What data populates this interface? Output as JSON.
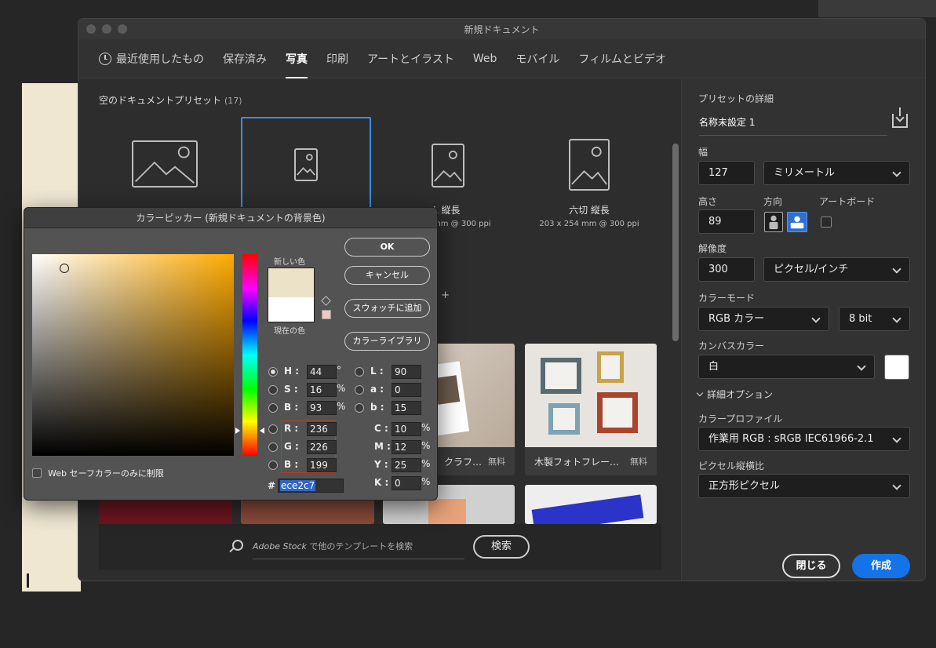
{
  "main_dialog": {
    "title": "新規ドキュメント",
    "tabs": [
      {
        "label": "最近使用したもの",
        "active": false
      },
      {
        "label": "保存済み",
        "active": false
      },
      {
        "label": "写真",
        "active": true
      },
      {
        "label": "印刷",
        "active": false
      },
      {
        "label": "アートとイラスト",
        "active": false
      },
      {
        "label": "Web",
        "active": false
      },
      {
        "label": "モバイル",
        "active": false
      },
      {
        "label": "フィルムとビデオ",
        "active": false
      }
    ]
  },
  "presets": {
    "header": "空のドキュメントプリセット",
    "count": "(17)",
    "items": [
      {
        "name": "",
        "sub": ""
      },
      {
        "name": "",
        "sub": ""
      },
      {
        "name": "L 縦長",
        "sub": "mm @ 300 ppi"
      },
      {
        "name": "六切 縦長",
        "sub": "203 x 254 mm @ 300 ppi"
      }
    ],
    "more": "示 +"
  },
  "templates": [
    {
      "label": "クラフ…",
      "free": "無料"
    },
    {
      "label": "木製フォトフレー…",
      "free": "無料"
    }
  ],
  "search": {
    "brand": "Adobe Stock",
    "placeholder": " で他のテンプレートを検索",
    "button": "検索"
  },
  "details": {
    "header": "プリセットの詳細",
    "doc_name": "名称未設定 1",
    "width_label": "幅",
    "width_value": "127",
    "width_unit": "ミリメートル",
    "height_label": "高さ",
    "height_value": "89",
    "orientation_label": "方向",
    "artboard_label": "アートボード",
    "resolution_label": "解像度",
    "resolution_value": "300",
    "resolution_unit": "ピクセル/インチ",
    "color_mode_label": "カラーモード",
    "color_mode": "RGB カラー",
    "bit_depth": "8 bit",
    "canvas_color_label": "カンバスカラー",
    "canvas_color": "白",
    "advanced": "詳細オプション",
    "profile_label": "カラープロファイル",
    "profile": "作業用 RGB : sRGB IEC61966-2.1",
    "aspect_label": "ピクセル縦横比",
    "aspect": "正方形ピクセル",
    "close_button": "閉じる",
    "create_button": "作成"
  },
  "picker": {
    "title": "カラーピッカー (新規ドキュメントの背景色)",
    "new_label": "新しい色",
    "current_label": "現在の色",
    "new_color": "#ece2c7",
    "current_color": "#ffffff",
    "ok": "OK",
    "cancel": "キャンセル",
    "add_swatch": "スウォッチに追加",
    "libraries": "カラーライブラリ",
    "H": {
      "label": "H :",
      "value": "44",
      "unit": "°"
    },
    "S": {
      "label": "S :",
      "value": "16",
      "unit": "%"
    },
    "B": {
      "label": "B :",
      "value": "93",
      "unit": "%"
    },
    "R": {
      "label": "R :",
      "value": "236"
    },
    "G": {
      "label": "G :",
      "value": "226"
    },
    "Bl": {
      "label": "B :",
      "value": "199"
    },
    "L": {
      "label": "L :",
      "value": "90"
    },
    "a": {
      "label": "a :",
      "value": "0"
    },
    "b": {
      "label": "b :",
      "value": "15"
    },
    "C": {
      "label": "C :",
      "value": "10",
      "unit": "%"
    },
    "M": {
      "label": "M :",
      "value": "12",
      "unit": "%"
    },
    "Y": {
      "label": "Y :",
      "value": "25",
      "unit": "%"
    },
    "K": {
      "label": "K :",
      "value": "0",
      "unit": "%"
    },
    "hash": "#",
    "hex": "ece2c7",
    "websafe": "Web セーフカラーのみに制限"
  }
}
